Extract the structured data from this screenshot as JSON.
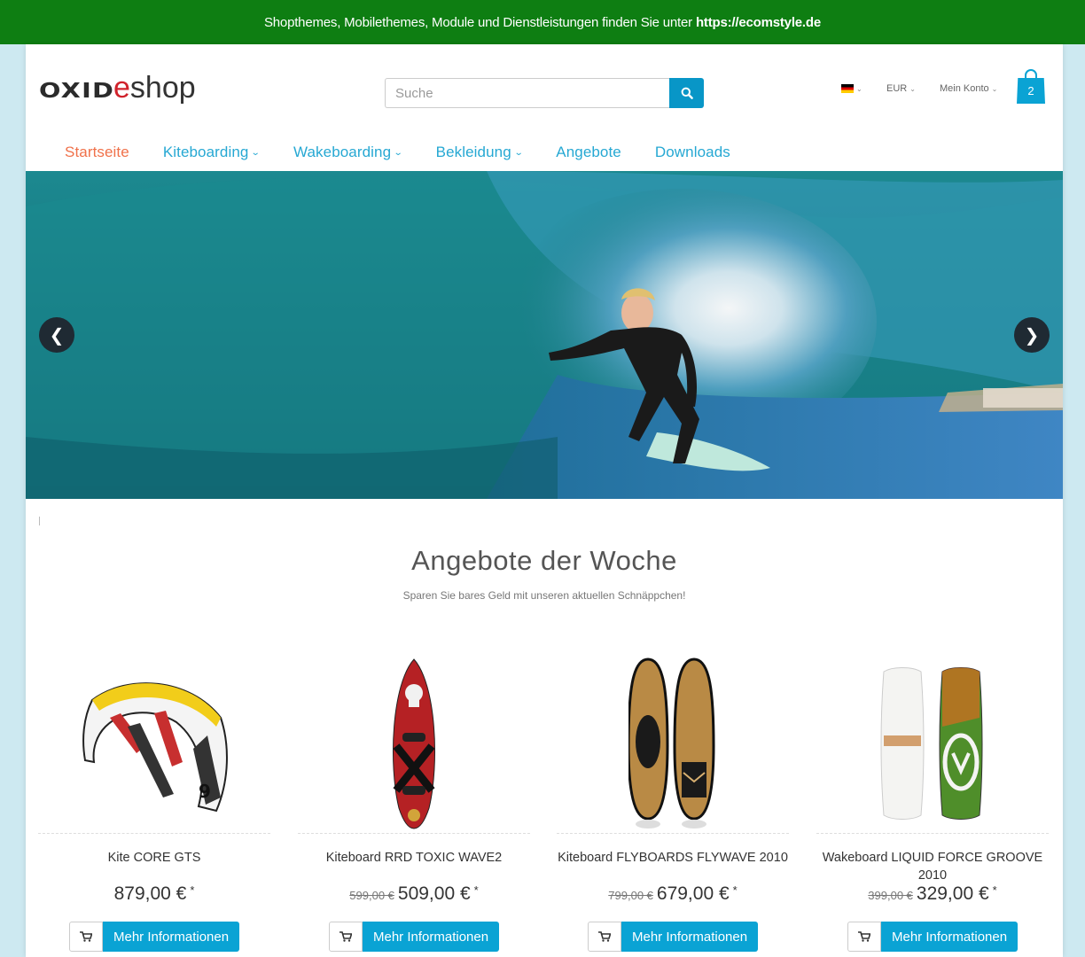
{
  "topbar": {
    "text": "Shopthemes, Mobilethemes, Module und Dienstleistungen finden Sie unter",
    "link": "https://ecomstyle.de"
  },
  "header": {
    "logo_oxid": "OXID",
    "logo_e": "e",
    "logo_shop": "shop",
    "search_placeholder": "Suche",
    "currency": "EUR",
    "account": "Mein Konto",
    "cart_count": "2"
  },
  "nav": {
    "items": [
      {
        "label": "Startseite",
        "active": true,
        "dropdown": false
      },
      {
        "label": "Kiteboarding",
        "dropdown": true
      },
      {
        "label": "Wakeboarding",
        "dropdown": true
      },
      {
        "label": "Bekleidung",
        "dropdown": true
      },
      {
        "label": "Angebote",
        "dropdown": false
      },
      {
        "label": "Downloads",
        "dropdown": false
      }
    ]
  },
  "offers": {
    "title": "Angebote der Woche",
    "subtitle": "Sparen Sie bares Geld mit unseren aktuellen Schnäppchen!"
  },
  "products": [
    {
      "name": "Kite CORE GTS",
      "old_price": "",
      "price": "879,00 €",
      "star": "*",
      "button": "Mehr Informationen"
    },
    {
      "name": "Kiteboard RRD TOXIC WAVE2",
      "old_price": "599,00 €",
      "price": "509,00 €",
      "star": "*",
      "button": "Mehr Informationen"
    },
    {
      "name": "Kiteboard FLYBOARDS FLYWAVE 2010",
      "old_price": "799,00 €",
      "price": "679,00 €",
      "star": "*",
      "button": "Mehr Informationen"
    },
    {
      "name": "Wakeboard LIQUID FORCE GROOVE 2010",
      "old_price": "399,00 €",
      "price": "329,00 €",
      "star": "*",
      "button": "Mehr Informationen"
    }
  ],
  "colors": {
    "topbar": "#0e7e12",
    "accent": "#0aa3d4",
    "nav_active": "#f0714a",
    "nav_link": "#26a8d3"
  }
}
